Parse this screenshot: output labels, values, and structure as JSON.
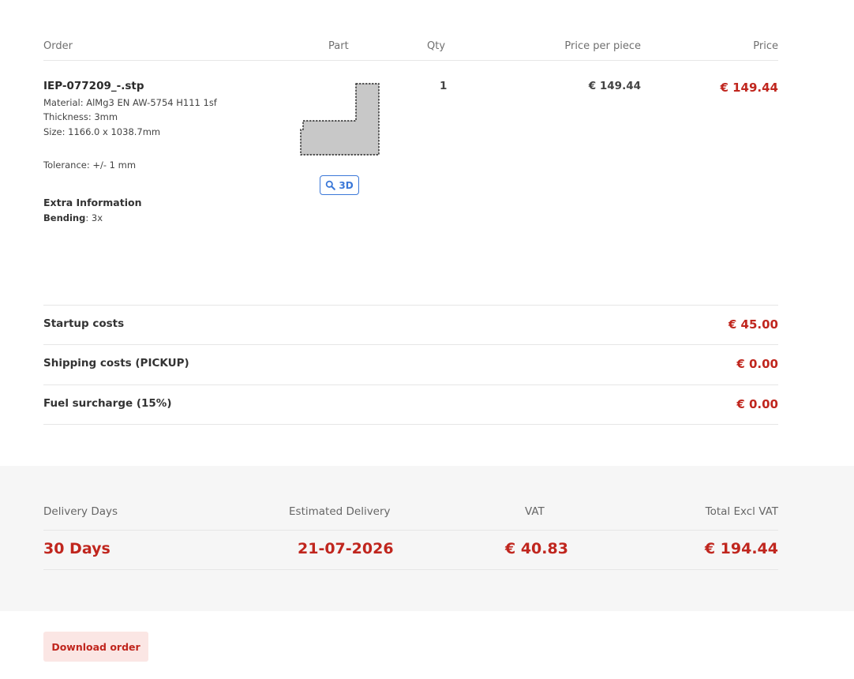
{
  "header": {
    "order": "Order",
    "part": "Part",
    "qty": "Qty",
    "price_per_piece": "Price per piece",
    "price": "Price"
  },
  "item": {
    "filename": "IEP-077209_-.stp",
    "material": "Material: AlMg3 EN AW-5754 H111 1sf",
    "thickness": "Thickness: 3mm",
    "size": "Size: 1166.0 x 1038.7mm",
    "tolerance": "Tolerance: +/- 1 mm",
    "extra_title": "Extra Information",
    "bending_label": "Bending",
    "bending_value": ": 3x",
    "view_3d_label": "3D",
    "qty": "1",
    "price_per_piece": "€ 149.44",
    "price": "€ 149.44"
  },
  "costs": [
    {
      "label": "Startup costs",
      "value": "€ 45.00"
    },
    {
      "label": "Shipping costs (PICKUP)",
      "value": "€ 0.00"
    },
    {
      "label": "Fuel surcharge (15%)",
      "value": "€ 0.00"
    }
  ],
  "summary": {
    "delivery_days_label": "Delivery Days",
    "delivery_days_value": "30 Days",
    "estimated_delivery_label": "Estimated Delivery",
    "estimated_delivery_value": "21-07-2026",
    "vat_label": "VAT",
    "vat_value": "€ 40.83",
    "total_label": "Total Excl VAT",
    "total_value": "€ 194.44"
  },
  "actions": {
    "download_label": "Download order"
  },
  "colors": {
    "accent": "#c0261e",
    "link_blue": "#3b78d8"
  }
}
